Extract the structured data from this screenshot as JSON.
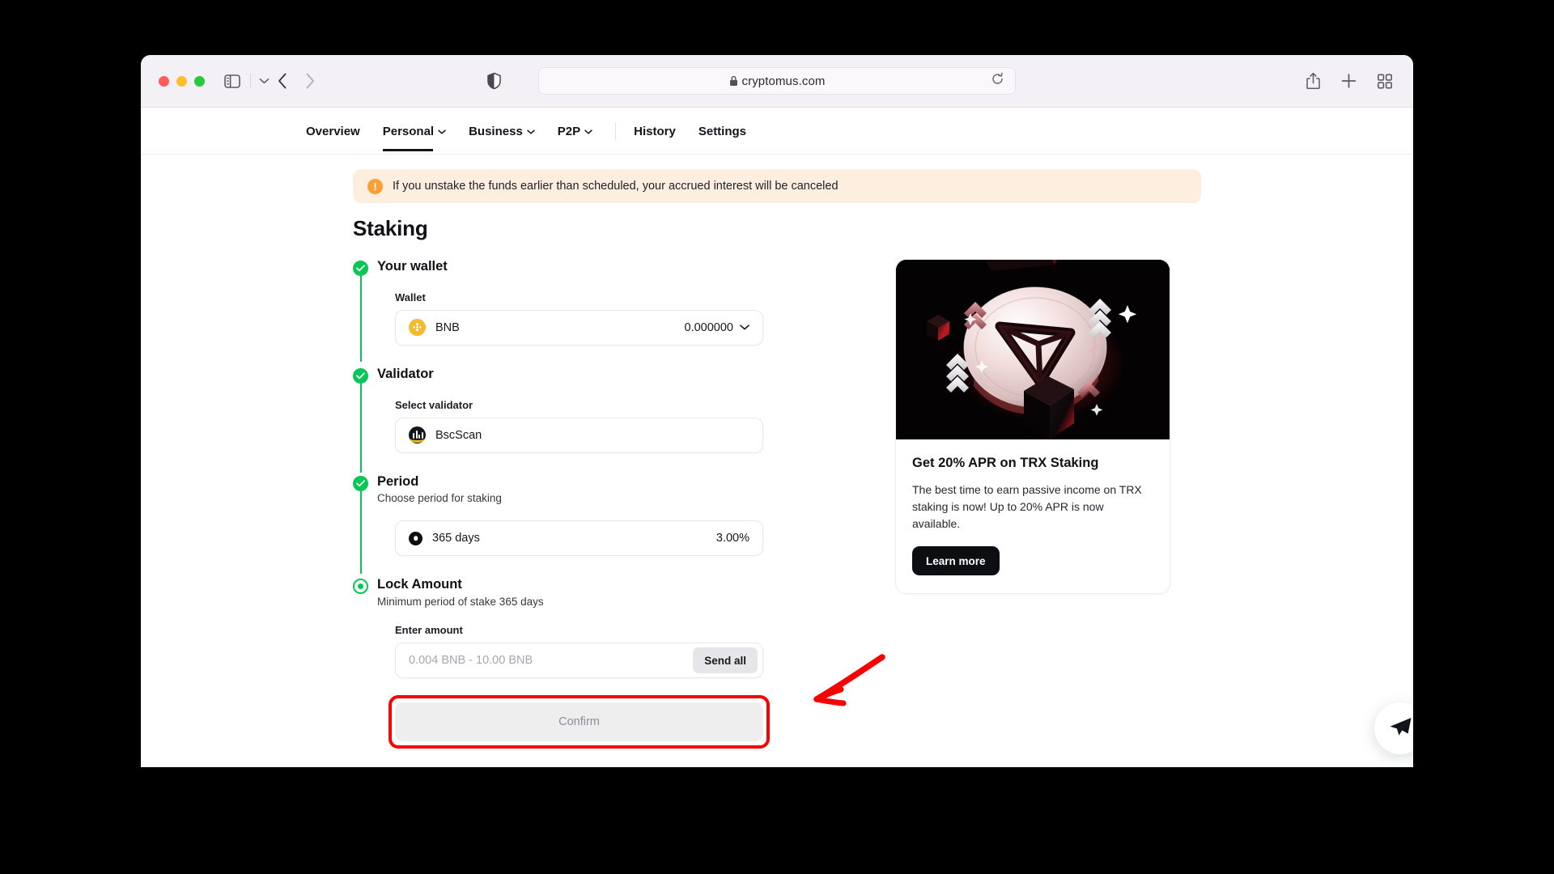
{
  "browser": {
    "url": "cryptomus.com",
    "lock_icon": "lock-icon",
    "reload_icon": "reload-icon",
    "share_icon": "share-icon",
    "new_tab_icon": "plus-icon",
    "tab_overview_icon": "grid-icon",
    "sidebar_icon": "sidebar-icon",
    "back_icon": "chevron-left-icon",
    "forward_icon": "chevron-right-icon",
    "shield_icon": "shield-icon"
  },
  "nav": {
    "items": [
      {
        "label": "Overview",
        "caret": "",
        "active": false
      },
      {
        "label": "Personal",
        "caret": "⌄",
        "active": true
      },
      {
        "label": "Business",
        "caret": "⌄",
        "active": false
      },
      {
        "label": "P2P",
        "caret": "⌄",
        "active": false
      },
      {
        "label": "History",
        "caret": "",
        "active": false
      },
      {
        "label": "Settings",
        "caret": "",
        "active": false
      }
    ]
  },
  "alert": {
    "icon": "warning-icon",
    "symbol": "!",
    "text": "If you unstake the funds earlier than scheduled, your accrued interest will be canceled",
    "bg_color": "#fdeedf",
    "icon_color": "#f7a033"
  },
  "page": {
    "title": "Staking"
  },
  "steps": {
    "wallet": {
      "heading": "Your wallet",
      "field_label": "Wallet",
      "coin_name": "BNB",
      "coin_icon": "bnb-icon",
      "balance": "0.000000",
      "chevron": "⌄"
    },
    "validator": {
      "heading": "Validator",
      "field_label": "Select validator",
      "name": "BscScan",
      "icon": "bscscan-icon"
    },
    "period": {
      "heading": "Period",
      "subtitle": "Choose period for staking",
      "option_label": "365 days",
      "option_rate": "3.00%"
    },
    "lock": {
      "heading": "Lock Amount",
      "subtitle": "Minimum period of stake 365 days",
      "field_label": "Enter amount",
      "amount_value": "",
      "amount_placeholder": "0.004 BNB - 10.00 BNB",
      "send_all_label": "Send all"
    },
    "confirm_label": "Confirm"
  },
  "promo": {
    "title": "Get 20% APR on TRX Staking",
    "text": "The best time to earn passive income on TRX staking is now! Up to 20% APR is now available.",
    "button_label": "Learn more",
    "image_icon": "tron-coin-3d"
  },
  "widgets": {
    "chat_icon": "paper-plane-icon"
  },
  "annotation": {
    "highlight_color": "#fb0000",
    "arrow_icon": "red-arrow-icon",
    "target": "confirm-button"
  },
  "colors": {
    "accent_green": "#06c755",
    "annotation_red": "#fb0000",
    "bnb_gold": "#f3ba2f"
  }
}
